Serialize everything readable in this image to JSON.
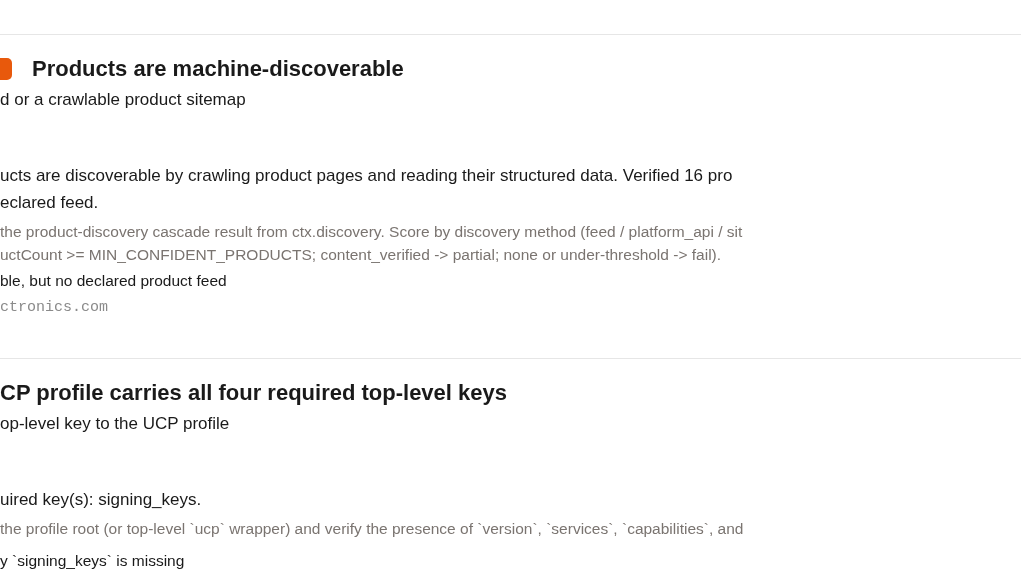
{
  "checks": [
    {
      "has_badge": true,
      "title": "Products are machine-discoverable",
      "recommendation": "d or a crawlable product sitemap",
      "detail": [
        "ucts are discoverable by crawling product pages and reading their structured data. Verified 16 pro",
        "eclared feed."
      ],
      "method": [
        "the product-discovery cascade result from ctx.discovery. Score by discovery method (feed / platform_api / sit",
        "uctCount >= MIN_CONFIDENT_PRODUCTS; content_verified -> partial; none or under-threshold -> fail)."
      ],
      "summary": "ble, but no declared product feed",
      "url": "ctronics.com"
    },
    {
      "has_badge": false,
      "title": "CP profile carries all four required top-level keys",
      "recommendation": "op-level key to the UCP profile",
      "detail": [
        "uired key(s): signing_keys."
      ],
      "method": [
        "the profile root (or top-level `ucp` wrapper) and verify the presence of `version`, `services`, `capabilities`, and"
      ],
      "summary": "y `signing_keys` is missing"
    }
  ]
}
